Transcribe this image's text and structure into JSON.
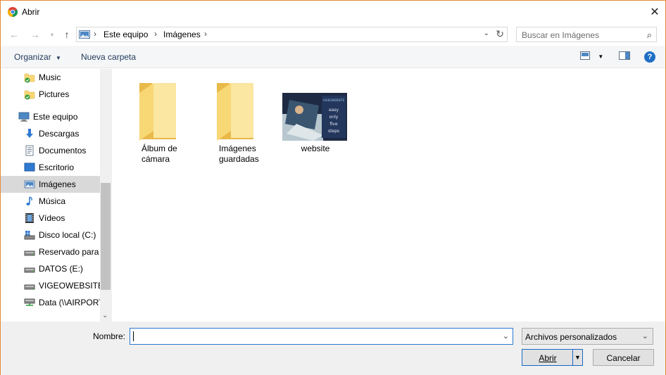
{
  "window": {
    "title": "Abrir"
  },
  "address": {
    "crumbs": [
      "Este equipo",
      "Imágenes"
    ],
    "search_placeholder": "Buscar en Imágenes"
  },
  "toolbar": {
    "organize_label": "Organizar",
    "new_folder_label": "Nueva carpeta"
  },
  "nav": {
    "items": [
      {
        "label": "Music",
        "icon": "folder-check-icon",
        "indent": 2
      },
      {
        "label": "Pictures",
        "icon": "folder-check-icon",
        "indent": 2
      },
      {
        "label": "Este equipo",
        "icon": "computer-icon",
        "indent": 1
      },
      {
        "label": "Descargas",
        "icon": "download-icon",
        "indent": 2
      },
      {
        "label": "Documentos",
        "icon": "document-icon",
        "indent": 2
      },
      {
        "label": "Escritorio",
        "icon": "desktop-icon",
        "indent": 2
      },
      {
        "label": "Imágenes",
        "icon": "pictures-icon",
        "indent": 2,
        "selected": true
      },
      {
        "label": "Música",
        "icon": "music-icon",
        "indent": 2
      },
      {
        "label": "Vídeos",
        "icon": "video-icon",
        "indent": 2
      },
      {
        "label": "Disco local (C:)",
        "icon": "drive-windows-icon",
        "indent": 2
      },
      {
        "label": "Reservado para el",
        "icon": "drive-icon",
        "indent": 2
      },
      {
        "label": "DATOS (E:)",
        "icon": "drive-icon",
        "indent": 2
      },
      {
        "label": "VIGEOWEBSITE (",
        "icon": "drive-icon",
        "indent": 2
      },
      {
        "label": "Data (\\\\AIRPORT",
        "icon": "network-drive-icon",
        "indent": 2
      }
    ]
  },
  "content": {
    "items": [
      {
        "label": "Álbum de cámara",
        "type": "folder"
      },
      {
        "label": "Imágenes guardadas",
        "type": "folder"
      },
      {
        "label": "website",
        "type": "image",
        "thumb_text": [
          "VIGEOWEBSITE",
          "easy",
          "only",
          "five",
          "steps"
        ]
      }
    ]
  },
  "bottom": {
    "name_label": "Nombre:",
    "name_value": "",
    "filter_value": "Archivos personalizados",
    "open_label": "Abrir",
    "cancel_label": "Cancelar"
  },
  "colors": {
    "accent": "#1f6fc5",
    "folder": "#f8d775",
    "selected": "#d9d9d9",
    "window_border": "#e88a3a"
  }
}
